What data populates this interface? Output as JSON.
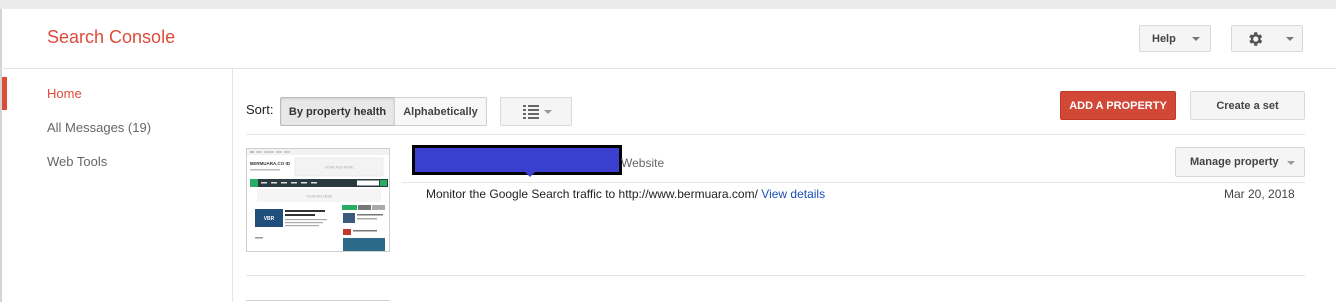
{
  "app": {
    "title": "Search Console"
  },
  "header": {
    "help_label": "Help",
    "gear_icon": "gear-icon"
  },
  "sidebar": {
    "items": [
      {
        "label": "Home",
        "active": true
      },
      {
        "label": "All Messages (19)",
        "active": false
      },
      {
        "label": "Web Tools",
        "active": false
      }
    ]
  },
  "toolbar": {
    "sort_label": "Sort:",
    "sort_options": [
      "By property health",
      "Alphabetically"
    ],
    "sort_selected": "By property health",
    "view_icon": "list-view-icon",
    "add_property_label": "ADD A PROPERTY",
    "create_set_label": "Create a set"
  },
  "property": {
    "type": "Website",
    "manage_label": "Manage property",
    "message_text": "Monitor the Google Search traffic to http://www.bermuara.com/",
    "view_details_label": "View details",
    "date": "Mar 20, 2018",
    "thumbnail": {
      "site_name": "BERMUARA.CO ID",
      "ad_text": "YOUR ADS HERE",
      "logo_text": "VBR"
    }
  },
  "colors": {
    "brand": "#dd4b39",
    "add_button": "#d14836",
    "link": "#1a4fb6",
    "redaction": "#3b3fcf"
  }
}
